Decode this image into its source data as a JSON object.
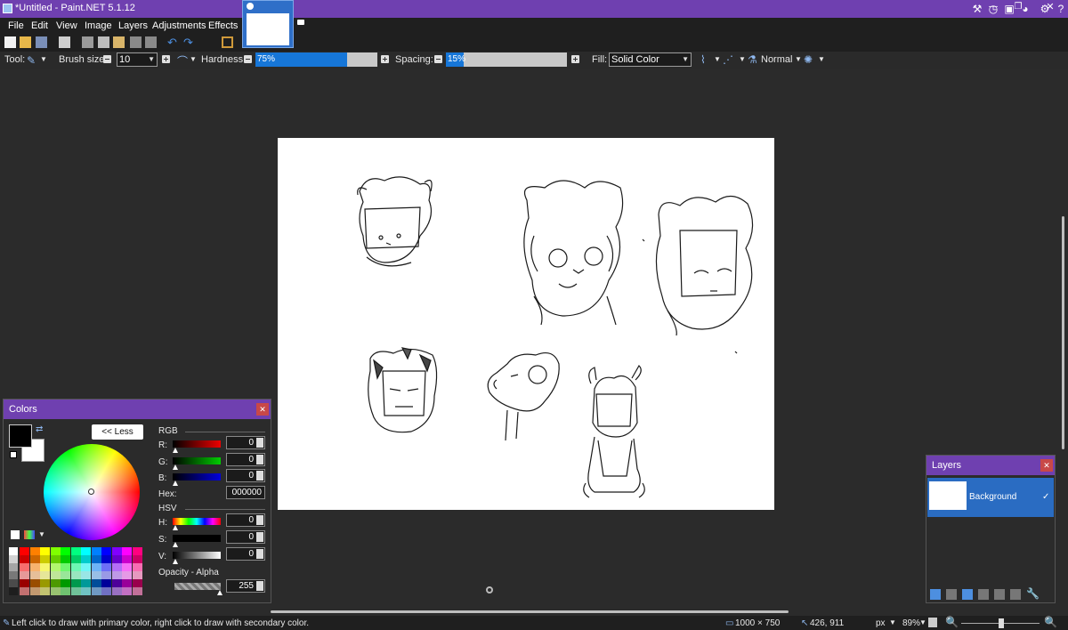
{
  "window": {
    "title": "*Untitled - Paint.NET 5.1.12"
  },
  "menu": [
    "File",
    "Edit",
    "View",
    "Image",
    "Layers",
    "Adjustments",
    "Effects"
  ],
  "toolbar_options": {
    "tool_label": "Tool:",
    "brush_size_label": "Brush size:",
    "brush_size_value": "10",
    "hardness_label": "Hardness:",
    "hardness_value": "75%",
    "hardness_fraction": 0.75,
    "spacing_label": "Spacing:",
    "spacing_value": "15%",
    "spacing_fraction": 0.15,
    "fill_label": "Fill:",
    "fill_value": "Solid Color",
    "blend_mode": "Normal"
  },
  "colors_window": {
    "title": "Colors",
    "less_button": "<< Less",
    "rgb_label": "RGB",
    "r_label": "R:",
    "r_value": "0",
    "g_label": "G:",
    "g_value": "0",
    "b_label": "B:",
    "b_value": "0",
    "hex_label": "Hex:",
    "hex_value": "000000",
    "hsv_label": "HSV",
    "h_label": "H:",
    "h_value": "0",
    "s_label": "S:",
    "s_value": "0",
    "v_label": "V:",
    "v_value": "0",
    "opacity_label": "Opacity - Alpha",
    "alpha_value": "255",
    "primary_color": "#000000",
    "secondary_color": "#ffffff"
  },
  "layers_window": {
    "title": "Layers",
    "layers": [
      {
        "name": "Background",
        "visible": true
      }
    ]
  },
  "status": {
    "hint": "Left click to draw with primary color, right click to draw with secondary color.",
    "image_size": "1000 × 750",
    "cursor_pos": "426, 911",
    "unit": "px",
    "zoom": "89%"
  },
  "colors": {
    "accent": "#6f40b0",
    "selection": "#1676d8",
    "background": "#2b2b2b"
  }
}
